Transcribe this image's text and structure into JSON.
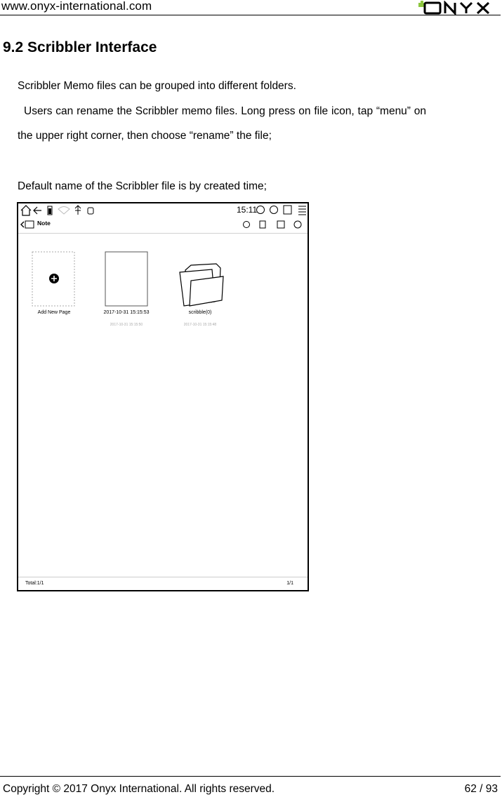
{
  "header": {
    "url": "www.onyx-international.com",
    "logo_text": "ONYX"
  },
  "section": {
    "title": "9.2 Scribbler Interface",
    "para1": "Scribbler Memo files can be grouped into different folders.",
    "para2": "Users can rename the Scribbler memo files. Long press on file icon, tap “menu” on",
    "para3": "the upper right corner, then choose “rename” the file;",
    "para4": "Default name of the Scribbler file is by created time;"
  },
  "screenshot": {
    "clock": "15:11",
    "app_title": "Note",
    "items": [
      {
        "label": "Add New Page",
        "sub": ""
      },
      {
        "label": "2017-10-31 15:15:53",
        "sub": "2017-10-31 15:15:50"
      },
      {
        "label": "scribble(0)",
        "sub": "2017-10-31 15:15:48"
      }
    ],
    "total": "Total:1/1",
    "page": "1/1"
  },
  "footer": {
    "copyright": "Copyright © 2017 Onyx International. All rights reserved.",
    "page": "62 / 93"
  }
}
